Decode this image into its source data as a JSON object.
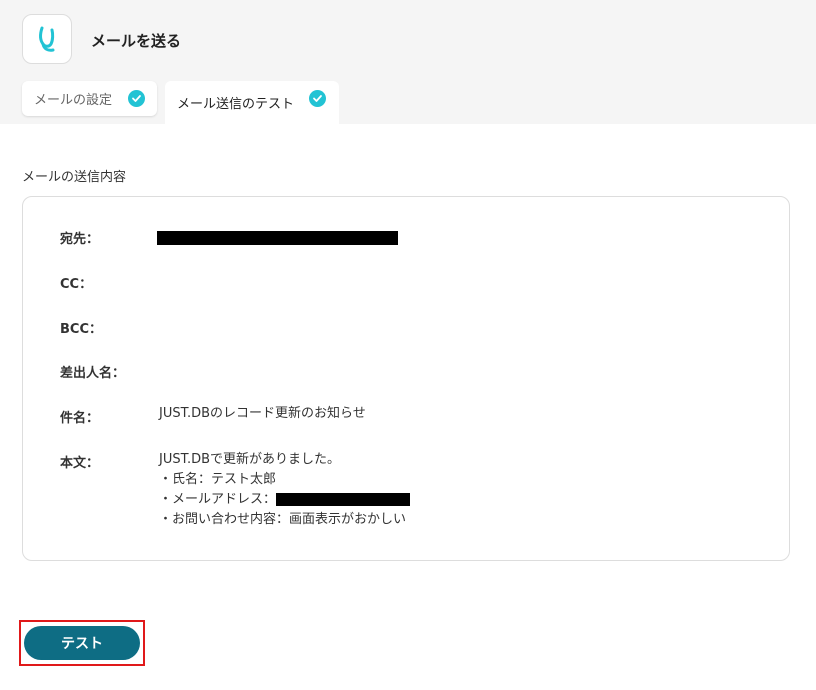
{
  "header": {
    "title": "メールを送る",
    "tabs": [
      {
        "label": "メールの設定"
      },
      {
        "label": "メール送信のテスト"
      }
    ]
  },
  "section": {
    "title": "メールの送信内容"
  },
  "mail": {
    "to_label": "宛先：",
    "cc_label": "CC：",
    "bcc_label": "BCC：",
    "sender_label": "差出人名：",
    "subject_label": "件名：",
    "subject_value": "JUST.DBのレコード更新のお知らせ",
    "body_label": "本文：",
    "body_line1": "JUST.DBで更新がありました。",
    "body_line2": "・氏名：テスト太郎",
    "body_line3_prefix": "・メールアドレス：",
    "body_line4": "・お問い合わせ内容：画面表示がおかしい"
  },
  "actions": {
    "test_label": "テスト"
  },
  "colors": {
    "accent": "#22c3d4",
    "button": "#0e6d84",
    "highlight": "#e0191a"
  }
}
